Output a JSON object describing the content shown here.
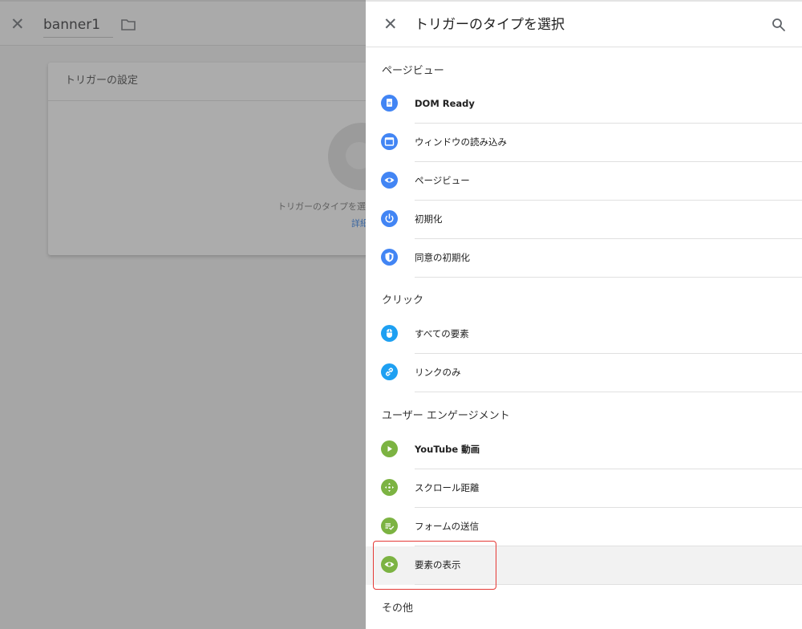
{
  "background": {
    "title": "banner1",
    "card_title": "トリガーの設定",
    "card_text": "トリガーのタイプを選",
    "card_link": "詳細"
  },
  "panel": {
    "title": "トリガーのタイプを選択",
    "sections": {
      "pageview": "ページビュー",
      "click": "クリック",
      "engagement": "ユーザー エンゲージメント",
      "other": "その他"
    },
    "items": {
      "dom_ready": "DOM Ready",
      "window_loaded": "ウィンドウの読み込み",
      "page_view": "ページビュー",
      "initialization": "初期化",
      "consent_initialization": "同意の初期化",
      "all_elements": "すべての要素",
      "just_links": "リンクのみ",
      "youtube_video": "YouTube 動画",
      "scroll_depth": "スクロール距離",
      "form_submission": "フォームの送信",
      "element_visibility": "要素の表示"
    }
  },
  "colors": {
    "blue": "#4285f4",
    "light_blue": "#1ea0f2",
    "green": "#7cb342",
    "highlight": "#e53935"
  }
}
